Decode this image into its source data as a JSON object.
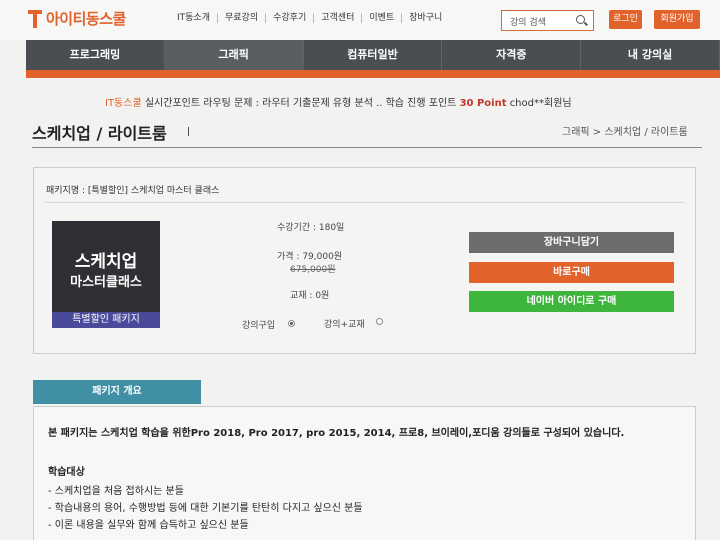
{
  "header": {
    "logo": "아이티동스쿨",
    "nav": [
      "IT동소개",
      "무료강의",
      "수강후기",
      "고객센터",
      "이벤트",
      "장바구니"
    ],
    "search_placeholder": "강의 검색",
    "login_label": "로그인",
    "join_label": "회원가입"
  },
  "main_nav": [
    "프로그래밍",
    "그래픽",
    "컴퓨터일반",
    "자격증",
    "내 강의실"
  ],
  "ticker": {
    "brand": "IT동스쿨",
    "prefix": "실시간포인트",
    "message": "라우팅 문제 : 라우터 기출문제 유형 분석 .. 학습 진행 포인트",
    "points": "30 Point",
    "user": "chod**회원님"
  },
  "page": {
    "title": "스케치업 / 라이트룸",
    "breadcrumb": "그래픽 > 스케치업 / 라이트룸"
  },
  "package": {
    "name_line": "패키지명 : [특별할인] 스케치업 마스터 클래스",
    "thumb_line1": "스케치업",
    "thumb_line2": "마스터클래스",
    "thumb_band": "특별할인 패키지",
    "period": "수강기간 : 180일",
    "price": "가격 : 79,000원",
    "original_price": "675,000원",
    "material": "교재 : 0원",
    "option_lecture": "강의구입",
    "option_lecture_book": "강의+교재",
    "selected_option": "강의구입",
    "btn_cart": "장바구니담기",
    "btn_buy": "바로구매",
    "btn_naver": "네이버 아이디로 구매"
  },
  "overview": {
    "tab_label": "패키지 개요",
    "intro": "본 패키지는 스케치업 학습을 위한Pro 2018, Pro 2017, pro 2015, 2014, 프로8, 브이레이,포디움 강의들로 구성되어 있습니다.",
    "target_heading": "학습대상",
    "targets": [
      "- 스케치업을 처음 접하시는 분들",
      "- 학습내용의 용어, 수행방법 등에 대한 기본기를 탄탄히 다지고 싶으신 분들",
      "- 이론 내용을 실무와 함께 습득하고 싶으신 분들"
    ]
  },
  "colors": {
    "accent": "#e2622c",
    "nav_bg": "#4a4e52",
    "teal": "#3f8fa5",
    "green": "#3eb63e"
  }
}
